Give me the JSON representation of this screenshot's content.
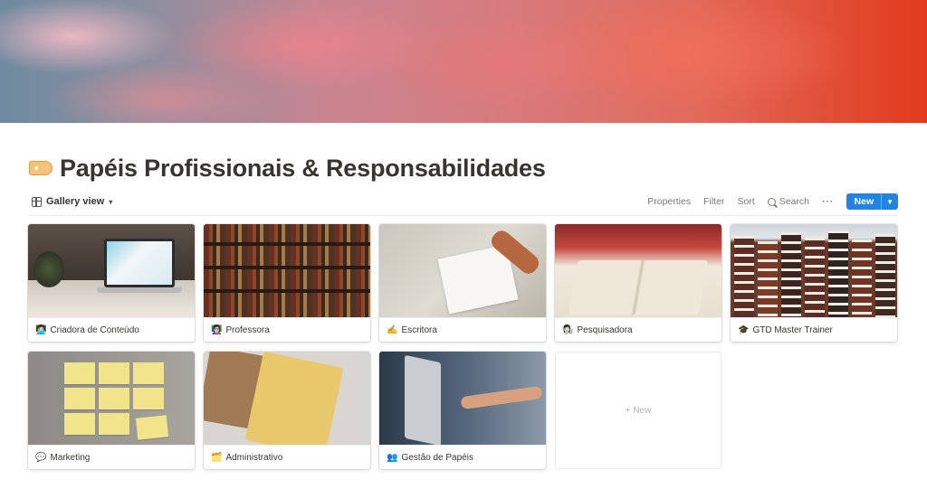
{
  "page": {
    "title": "Papéis Profissionais & Responsabilidades",
    "title_icon": "tag-icon"
  },
  "toolbar": {
    "view_label": "Gallery view",
    "properties": "Properties",
    "filter": "Filter",
    "sort": "Sort",
    "search": "Search",
    "more": "···",
    "new_label": "New",
    "new_color": "#2383e2"
  },
  "gallery": {
    "cards": [
      {
        "emoji": "👩🏻‍💻",
        "label": "Criadora de Conteúdo",
        "image": "laptop-desk"
      },
      {
        "emoji": "👩🏻‍🏫",
        "label": "Professora",
        "image": "bookshelf"
      },
      {
        "emoji": "✍️",
        "label": "Escritora",
        "image": "writing-notebook"
      },
      {
        "emoji": "👩🏻‍🔬",
        "label": "Pesquisadora",
        "image": "open-book"
      },
      {
        "emoji": "🎓",
        "label": "GTD Master Trainer",
        "image": "canal-houses"
      },
      {
        "emoji": "💬",
        "label": "Marketing",
        "image": "sticky-notes"
      },
      {
        "emoji": "🗂️",
        "label": "Administrativo",
        "image": "notebooks"
      },
      {
        "emoji": "👥",
        "label": "Gestão de Papéis",
        "image": "laptop-hand"
      }
    ],
    "new_card_label": "+ New"
  }
}
